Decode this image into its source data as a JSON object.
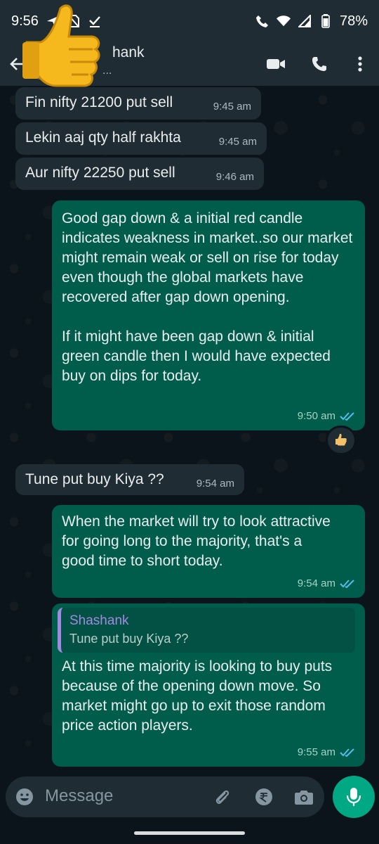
{
  "status_bar": {
    "time": "9:56",
    "battery": "78%",
    "icons": [
      "send-icon",
      "no-sim-icon",
      "checkmark-icon",
      "wifi-calling-icon",
      "wifi-icon",
      "signal-icon",
      "battery-icon"
    ]
  },
  "header": {
    "contact_name_visible": "hank",
    "subtitle_visible": "...",
    "icons": [
      "back-arrow-icon",
      "video-call-icon",
      "voice-call-icon",
      "more-options-icon"
    ]
  },
  "messages": [
    {
      "direction": "in",
      "text": "Fin nifty 21200 put sell",
      "time": "9:45 am"
    },
    {
      "direction": "in",
      "text": "Lekin aaj qty half rakhta",
      "time": "9:45 am"
    },
    {
      "direction": "in",
      "text": "Aur nifty 22250 put sell",
      "time": "9:46 am"
    },
    {
      "direction": "out",
      "paragraph1": "Good gap down & a initial red candle indicates weakness in market..so our market might remain weak or sell on rise for today even though the global markets have recovered after gap down opening.",
      "paragraph2": "If it might have been gap down & initial green candle then I would have expected buy on dips for today.",
      "time": "9:50 am",
      "reaction": "thumbs-up"
    },
    {
      "direction": "in",
      "text": "Tune put buy Kiya ??",
      "time": "9:54 am"
    },
    {
      "direction": "out",
      "text": "When the market will try to look attractive for going long to the majority, that's a good time to short today.",
      "time": "9:54 am"
    },
    {
      "direction": "out",
      "quote": {
        "author": "Shashank",
        "text": "Tune put buy Kiya ??"
      },
      "text": "At this time majority is looking to buy puts because of the opening down move. So market might go up to exit those random price action players.",
      "time": "9:55 am"
    }
  ],
  "input": {
    "placeholder": "Message",
    "icons": [
      "emoji-icon",
      "attach-icon",
      "rupee-payment-icon",
      "camera-icon",
      "microphone-icon"
    ]
  },
  "colors": {
    "background": "#0b141a",
    "bar": "#1f2c34",
    "incoming": "#202c33",
    "outgoing": "#005c4b",
    "accent": "#00a884",
    "read_ticks": "#53bdeb",
    "quote_author": "#a08be0"
  }
}
